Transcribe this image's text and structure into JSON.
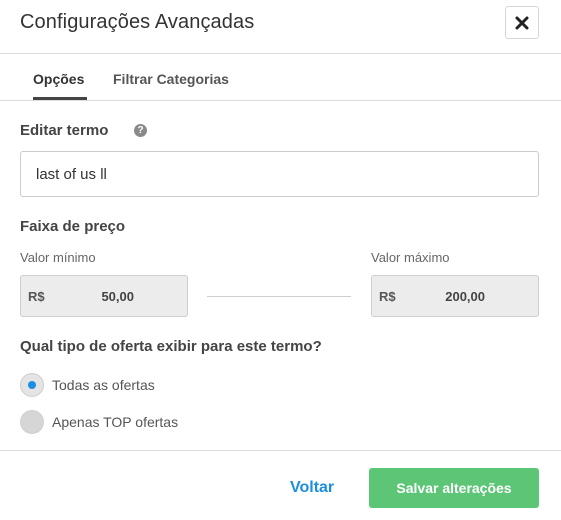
{
  "dialog": {
    "title": "Configurações Avançadas"
  },
  "tabs": [
    {
      "label": "Opções",
      "active": true
    },
    {
      "label": "Filtrar Categorias",
      "active": false
    }
  ],
  "edit_term": {
    "label": "Editar termo",
    "help_icon": "?",
    "value": "last of us ll"
  },
  "price_range": {
    "label": "Faixa de preço",
    "min_label": "Valor mínimo",
    "max_label": "Valor máximo",
    "currency": "R$",
    "min_value": "50,00",
    "max_value": "200,00"
  },
  "offer_type": {
    "question": "Qual tipo de oferta exibir para este termo?",
    "options": [
      {
        "label": "Todas as ofertas",
        "selected": true
      },
      {
        "label": "Apenas TOP ofertas",
        "selected": false
      }
    ]
  },
  "footer": {
    "back_label": "Voltar",
    "save_label": "Salvar alterações"
  },
  "colors": {
    "accent_blue": "#1a8fe0",
    "save_green": "#5cc576"
  }
}
